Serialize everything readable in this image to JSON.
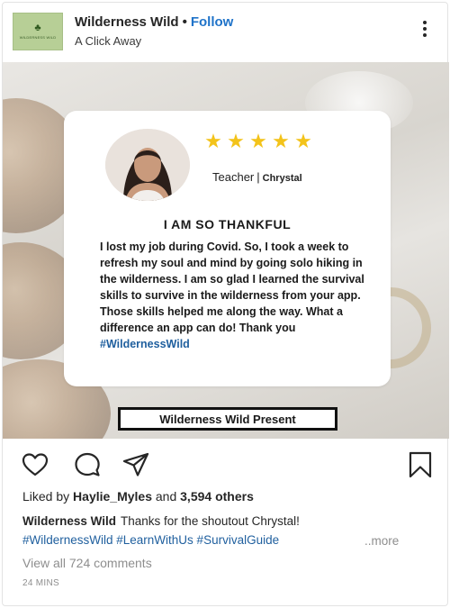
{
  "header": {
    "account_name": "Wilderness Wild",
    "separator": "•",
    "follow_label": "Follow",
    "subtitle": "A Click Away",
    "avatar_icon": "leaf-logo-icon",
    "avatar_text": "WILDERNESS WILD",
    "more_icon": "more-vertical-icon"
  },
  "post": {
    "card": {
      "stars": [
        "★",
        "★",
        "★",
        "★",
        "★"
      ],
      "rating": 5,
      "role": "Teacher",
      "role_sep": "|",
      "name": "Chrystal",
      "title": "I AM SO THANKFUL",
      "body": "I lost my job during Covid. So, I took a week to refresh my soul and mind by going solo hiking in the wilderness. I am so glad I learned the survival skills to survive in the wilderness from your app. Those skills helped me along the way. What a difference an app can do! Thank you ",
      "body_hashtag": "#WildernessWild"
    },
    "banner": "Wilderness Wild Present"
  },
  "actions": {
    "like_icon": "heart-icon",
    "comment_icon": "comment-icon",
    "share_icon": "send-icon",
    "save_icon": "bookmark-icon"
  },
  "engagement": {
    "liked_by_prefix": "Liked by ",
    "liked_by_user": "Haylie_Myles",
    "liked_by_mid": " and ",
    "liked_by_count": "3,594 others"
  },
  "caption": {
    "author": "Wilderness Wild",
    "text": "Thanks for the shoutout Chrystal!",
    "hashtags": "#WildernessWild #LearnWithUs #SurvivalGuide",
    "more_label": "..more"
  },
  "comments": {
    "view_all": "View all 724 comments"
  },
  "timestamp": "24 MINS",
  "colors": {
    "link": "#1f73c9",
    "hashtag": "#1f5f9e",
    "star": "#f3c31a",
    "muted": "#8e8e8e"
  }
}
